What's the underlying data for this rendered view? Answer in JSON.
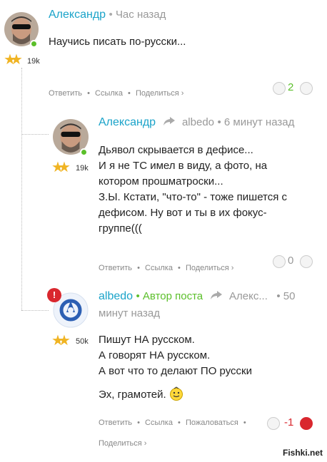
{
  "comments": [
    {
      "author": "Александр",
      "time": "Час назад",
      "karma": "19k",
      "lines": [
        "Научись писать по-русски..."
      ],
      "actions": [
        "Ответить",
        "•",
        "Ссылка",
        "•",
        "Поделиться ›"
      ],
      "score": "2",
      "score_color": "#5bbf2a"
    },
    {
      "author": "Александр",
      "reply_to": "albedo",
      "time": "• 6 минут назад",
      "karma": "19k",
      "lines": [
        "Дьявол скрывается в дефисе...",
        "И я не ТС имел в виду, а фото, на",
        "котором прошматроски...",
        "З.Ы. Кстати, \"что-то\" - тоже пишется с",
        "дефисом. Ну вот и ты в их фокус-",
        "группе((("
      ],
      "actions": [
        "Ответить",
        "•",
        "Ссылка",
        "•",
        "Поделиться ›"
      ],
      "score": "0",
      "score_color": "#999999"
    },
    {
      "author": "albedo",
      "author_badge": "• Автор поста",
      "reply_to": "Алекс...",
      "time_line1": "• 50",
      "time_line2": "минут назад",
      "karma": "50k",
      "alert": "!",
      "lines": [
        "Пишут НА русском.",
        "А говорят НА русском.",
        "А вот что то делают ПО русски"
      ],
      "last_line": "Эх, грамотей.",
      "actions": [
        "Ответить",
        "•",
        "Ссылка",
        "•",
        "Пожаловаться",
        "•"
      ],
      "actions2": "Поделиться ›",
      "score": "-1",
      "score_color": "#d9272e"
    }
  ],
  "watermark": "Fishki.net",
  "icons": [
    "reply-arrow-icon",
    "thumb-up-icon",
    "thumb-down-icon",
    "star-icon",
    "smiley-icon"
  ]
}
